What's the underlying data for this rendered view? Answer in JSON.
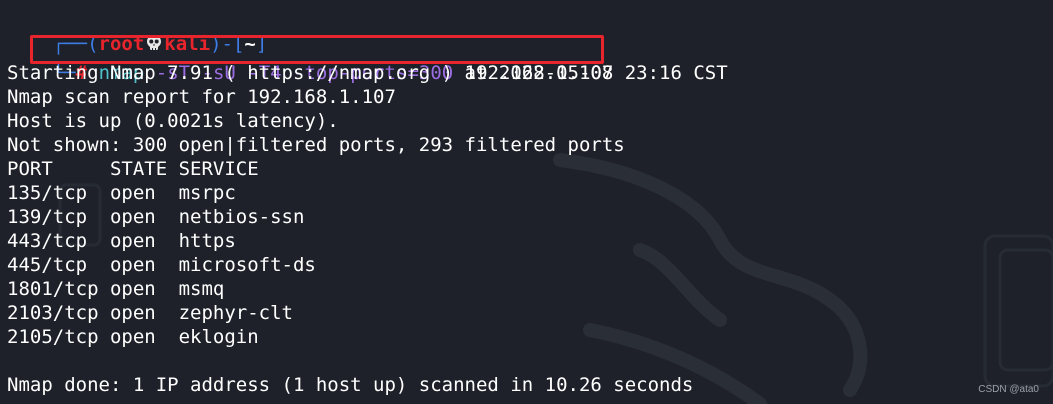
{
  "prompt": {
    "frame_open": "┌──(",
    "user": "root",
    "skull_icon": "skull-icon",
    "host": "kali",
    "frame_mid": ")-[",
    "cwd": "~",
    "frame_close": "]",
    "frame_bottom": "└─",
    "symbol": "#"
  },
  "command": {
    "program": "nmap",
    "options": "-sT -sU -T4 -top-ports=300",
    "target": "192.168.1.107"
  },
  "output": {
    "start": "Starting Nmap 7.91 ( https://nmap.org ) at 2022-05-08 23:16 CST",
    "report": "Nmap scan report for 192.168.1.107",
    "host_up": "Host is up (0.0021s latency).",
    "not_shown": "Not shown: 300 open|filtered ports, 293 filtered ports",
    "header": "PORT     STATE SERVICE",
    "ports": [
      "135/tcp  open  msrpc",
      "139/tcp  open  netbios-ssn",
      "443/tcp  open  https",
      "445/tcp  open  microsoft-ds",
      "1801/tcp open  msmq",
      "2103/tcp open  zephyr-clt",
      "2105/tcp open  eklogin"
    ],
    "done": "Nmap done: 1 IP address (1 host up) scanned in 10.26 seconds"
  },
  "watermark_credit": "CSDN @ata0",
  "colors": {
    "background": "#1e2129",
    "prompt_frame": "#3d7de6",
    "prompt_user": "#e8242c",
    "command": "#4ec2c9",
    "options": "#9b6de0",
    "highlight_box": "#e8242c"
  }
}
